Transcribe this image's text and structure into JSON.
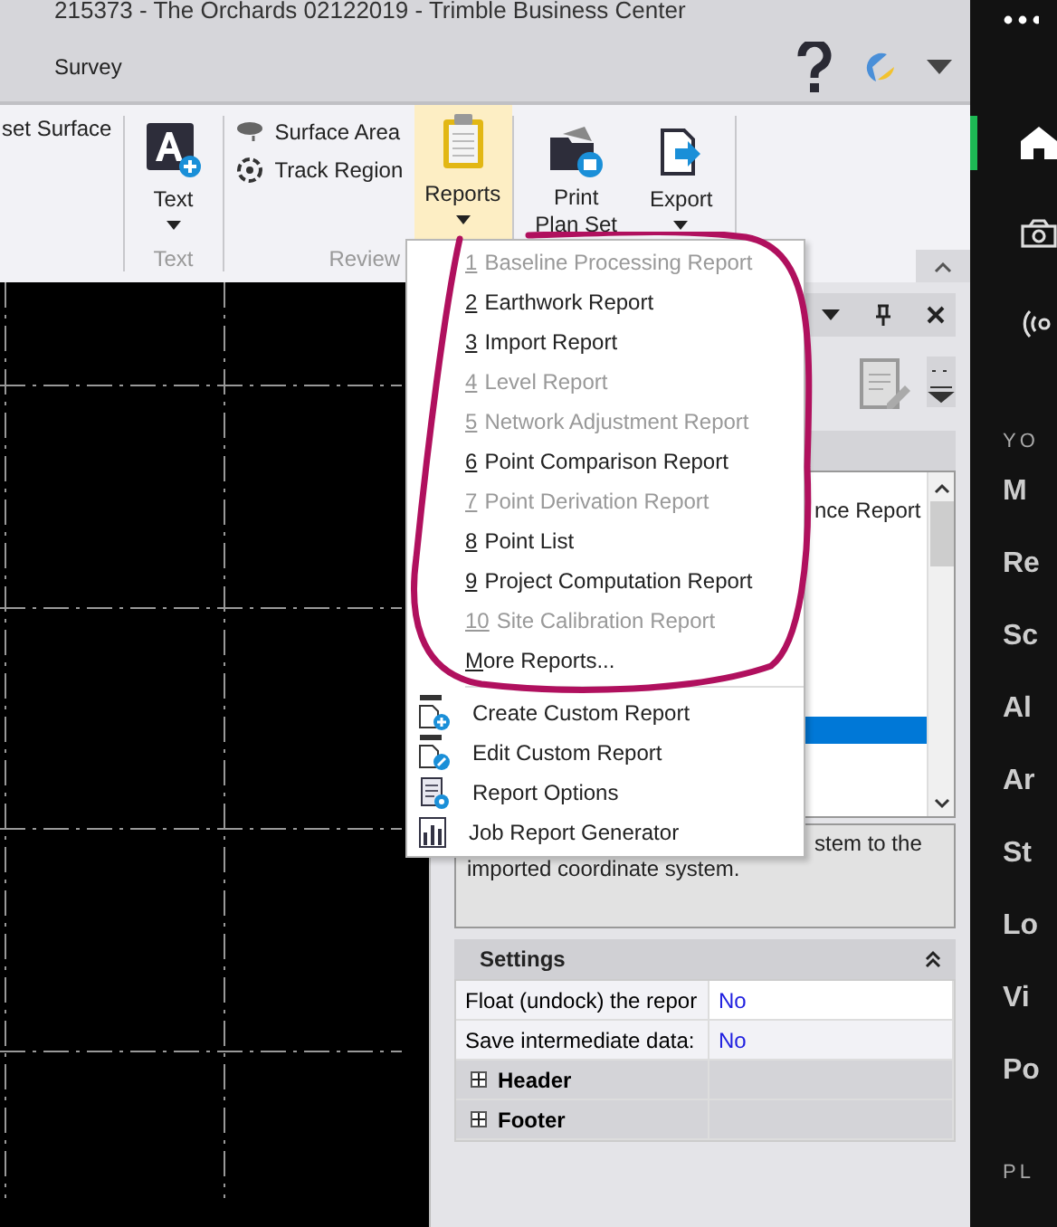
{
  "window": {
    "title": "215373 - The Orchards 02122019 - Trimble Business Center"
  },
  "ribbon_tabs": [
    {
      "label": "Survey",
      "selected": false
    }
  ],
  "ribbon": {
    "cut_item": "set Surface",
    "text_group": {
      "button": "Text",
      "label": "Text"
    },
    "review_group": {
      "items": [
        "Surface Area",
        "Track Region"
      ],
      "reports_button": {
        "label": "Reports",
        "pressed": true
      },
      "label": "Review"
    },
    "print_button": {
      "line_1": "Print",
      "line_2": "Plan Set"
    },
    "export_button": "Export"
  },
  "reports_menu": {
    "items": [
      {
        "kind": "numbered",
        "key": "1",
        "text": "Baseline Processing Report",
        "disabled": true
      },
      {
        "kind": "numbered",
        "key": "2",
        "text": "Earthwork Report",
        "disabled": false
      },
      {
        "kind": "numbered",
        "key": "3",
        "text": "Import Report",
        "disabled": false
      },
      {
        "kind": "numbered",
        "key": "4",
        "text": "Level Report",
        "disabled": true
      },
      {
        "kind": "numbered",
        "key": "5",
        "text": "Network Adjustment Report",
        "disabled": true
      },
      {
        "kind": "numbered",
        "key": "6",
        "text": "Point Comparison Report",
        "disabled": false
      },
      {
        "kind": "numbered",
        "key": "7",
        "text": "Point Derivation Report",
        "disabled": true
      },
      {
        "kind": "numbered",
        "key": "8",
        "text": "Point List",
        "disabled": false
      },
      {
        "kind": "numbered",
        "key": "9",
        "text": "Project Computation Report",
        "disabled": false
      },
      {
        "kind": "numbered",
        "key": "10",
        "text": "Site Calibration Report",
        "disabled": true
      },
      {
        "kind": "mnemonic",
        "key": "M",
        "text": "ore Reports...",
        "disabled": false
      }
    ],
    "actions": [
      {
        "kind": "docx-add",
        "label": "Create Custom Report"
      },
      {
        "kind": "docx-edit",
        "label": "Edit Custom Report"
      },
      {
        "kind": "options",
        "label": "Report Options"
      },
      {
        "kind": "generator",
        "label": "Job Report Generator"
      }
    ]
  },
  "panel": {
    "list_rows": [
      {
        "text": "nce Report",
        "selected": false
      },
      {
        "selected": true
      }
    ],
    "description": [
      "stem to the",
      "imported coordinate system."
    ],
    "settings": {
      "title": "Settings",
      "expanded": true,
      "properties": [
        {
          "name": "Float (undock) the repor",
          "value": "No"
        },
        {
          "name": "Save intermediate data:",
          "value": "No"
        }
      ],
      "groups": [
        {
          "name": "Header",
          "expanded": false
        },
        {
          "name": "Footer",
          "expanded": false
        }
      ]
    }
  },
  "sidebar": {
    "nav": [
      {
        "kind": "home",
        "selected": true
      },
      {
        "kind": "camera",
        "selected": false
      },
      {
        "kind": "broadcast",
        "selected": false
      }
    ],
    "section_1": "YO",
    "items": [
      "M",
      "Re",
      "Sc",
      "Al",
      "Ar",
      "St",
      "Lo",
      "Vi",
      "Po"
    ],
    "section_2": "PL"
  }
}
